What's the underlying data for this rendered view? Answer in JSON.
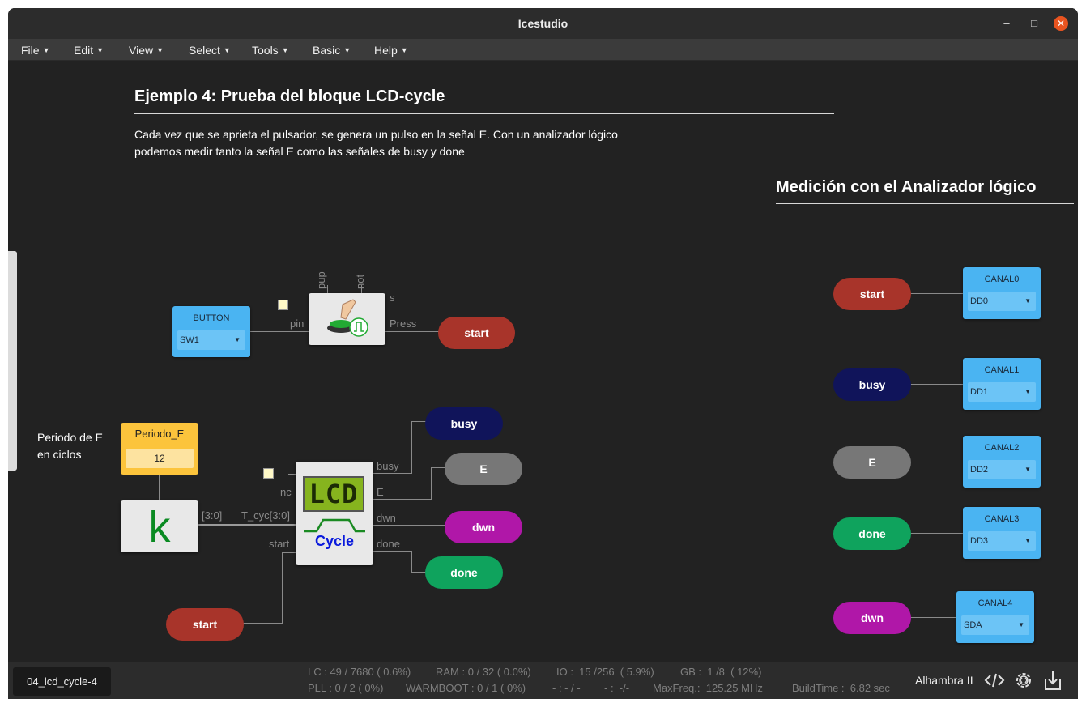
{
  "window": {
    "title": "Icestudio"
  },
  "menu": [
    {
      "label": "File"
    },
    {
      "label": "Edit"
    },
    {
      "label": "View"
    },
    {
      "label": "Select"
    },
    {
      "label": "Tools"
    },
    {
      "label": "Basic"
    },
    {
      "label": "Help"
    }
  ],
  "canvas": {
    "heading_main": "Ejemplo 4: Prueba del bloque LCD-cycle",
    "description_line1": "Cada vez que se aprieta el pulsador, se genera un pulso en la señal E. Con un analizador lógico",
    "description_line2": "podemos medir tanto la señal E como las señales de busy y done",
    "heading_analyzer": "Medición con el Analizador lógico",
    "comment_line1": "Periodo de E",
    "comment_line2": "en ciclos",
    "button_input": {
      "label": "BUTTON",
      "value": "SW1"
    },
    "button_block": {
      "port_pup": "pup",
      "port_not": "not",
      "port_s": "s",
      "port_pin": "pin",
      "port_press": "Press"
    },
    "constant": {
      "label": "Periodo_E",
      "value": "12"
    },
    "k_block": {
      "symbol": "k"
    },
    "bus_labels": {
      "range": "[3:0]",
      "tcyc": "T_cyc[3:0]"
    },
    "cycle_block": {
      "lcd_text": "LCD",
      "name": "Cycle",
      "port_nc": "nc",
      "port_start": "start",
      "port_busy": "busy",
      "port_e": "E",
      "port_dwn": "dwn",
      "port_done": "done"
    },
    "labels": {
      "start_btn": "start",
      "busy": "busy",
      "e": "E",
      "dwn": "dwn",
      "done": "done",
      "start_in": "start"
    },
    "analyzer": [
      {
        "signal": "start",
        "channel": "CANAL0",
        "pin": "DD0",
        "color": "#a8342a"
      },
      {
        "signal": "busy",
        "channel": "CANAL1",
        "pin": "DD1",
        "color": "#10145a"
      },
      {
        "signal": "E",
        "channel": "CANAL2",
        "pin": "DD2",
        "color": "#777777"
      },
      {
        "signal": "done",
        "channel": "CANAL3",
        "pin": "DD3",
        "color": "#0fa35d"
      },
      {
        "signal": "dwn",
        "channel": "CANAL4",
        "pin": "SDA",
        "color": "#b017a8"
      }
    ]
  },
  "status": {
    "project": "04_lcd_cycle-4",
    "lc": "LC : 49 / 7680 ( 0.6%)",
    "ram": "RAM : 0 / 32 ( 0.0%)",
    "io": "IO :  15 /256  ( 5.9%)",
    "gb": "GB :  1 /8  ( 12%)",
    "pll": "PLL : 0 / 2 ( 0%)",
    "warmboot": "WARMBOOT : 0 / 1 ( 0%)",
    "extra1": "- : - / -",
    "extra2": "- :  -/-",
    "maxfreq": "MaxFreq.:  125.25 MHz",
    "buildtime": "BuildTime :  6.82 sec",
    "board": "Alhambra II"
  },
  "colors": {
    "accent": "#e95420",
    "io_blue": "#4ab4f2",
    "start": "#a8342a",
    "busy": "#10145a",
    "e": "#777777",
    "dwn": "#b017a8",
    "done": "#0fa35d",
    "constant_yellow": "#fcc43c"
  }
}
